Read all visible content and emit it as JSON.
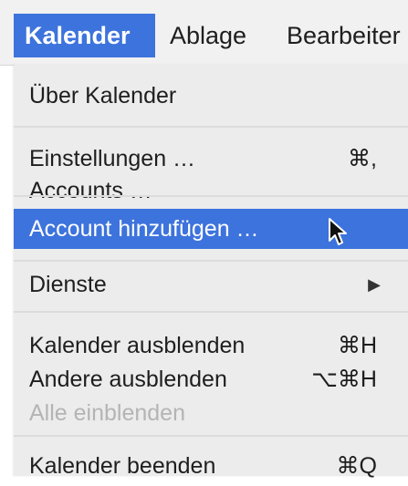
{
  "menubar": {
    "items": [
      "Kalender",
      "Ablage",
      "Bearbeiter"
    ]
  },
  "menu": {
    "about": "Über Kalender",
    "settings": {
      "label": "Einstellungen …",
      "shortcut": "⌘,"
    },
    "accounts": "Accounts …",
    "add_account": "Account hinzufügen …",
    "services": {
      "label": "Dienste",
      "arrow": "▶"
    },
    "hide_app": {
      "label": "Kalender ausblenden",
      "shortcut": "⌘H"
    },
    "hide_others": {
      "label": "Andere ausblenden",
      "shortcut": "⌥⌘H"
    },
    "show_all": "Alle einblenden",
    "quit": {
      "label": "Kalender beenden",
      "shortcut": "⌘Q"
    }
  },
  "colors": {
    "highlight": "#3d73dc",
    "menu_background": "#ececec",
    "disabled_text": "#b4b4b4"
  },
  "icons": {
    "cursor": "arrow-pointer-icon",
    "submenu": "submenu-arrow-icon"
  }
}
